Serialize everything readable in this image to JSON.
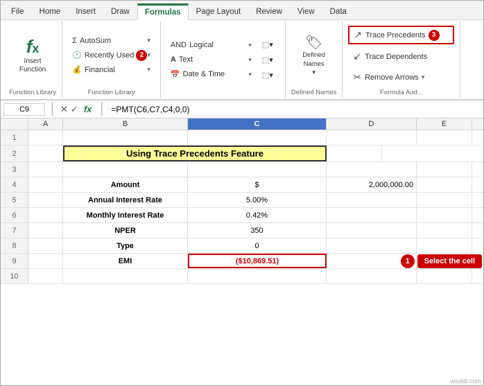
{
  "title": "wsxkb.com",
  "tabs": [
    {
      "label": "File",
      "active": false
    },
    {
      "label": "Home",
      "active": false
    },
    {
      "label": "Insert",
      "active": false
    },
    {
      "label": "Draw",
      "active": false
    },
    {
      "label": "Formulas",
      "active": true
    },
    {
      "label": "Page Layout",
      "active": false
    },
    {
      "label": "Review",
      "active": false
    },
    {
      "label": "View",
      "active": false
    },
    {
      "label": "Data",
      "active": false
    }
  ],
  "ribbon": {
    "function_library_label": "Function Library",
    "insert_function": {
      "label": "Insert\nFunction",
      "icon": "𝑓𝑥"
    },
    "autosum": {
      "label": "AutoSum",
      "arrow": "▾"
    },
    "recently_used": {
      "label": "Recently Used",
      "arrow": "▾"
    },
    "financial": {
      "label": "Financial",
      "arrow": "▾"
    },
    "logical": {
      "label": "Logical",
      "arrow": "▾"
    },
    "text": {
      "label": "Text",
      "arrow": "▾"
    },
    "date_time": {
      "label": "Date & Time",
      "arrow": "▾"
    },
    "more_col1_btn1": "▤",
    "more_col1_btn2": "▤",
    "more_col1_btn3": "▤",
    "defined_names_label": "Defined\nNames",
    "formula_audit_label": "Formula Aud...",
    "trace_precedents": "Trace Precedents",
    "trace_dependents": "Trace Dependents",
    "remove_arrows": "Remove Arrows",
    "badge2": "2",
    "badge3": "3"
  },
  "formula_bar": {
    "cell_ref": "C9",
    "formula": "=PMT(C6,C7,C4,0,0)"
  },
  "spreadsheet": {
    "col_headers": [
      "A",
      "B",
      "C",
      "D",
      "E"
    ],
    "rows": [
      {
        "num": "1",
        "cells": [
          "",
          "",
          "",
          "",
          ""
        ]
      },
      {
        "num": "2",
        "cells": [
          "",
          "Using Trace Precedents Feature",
          "",
          "",
          ""
        ]
      },
      {
        "num": "3",
        "cells": [
          "",
          "",
          "",
          "",
          ""
        ]
      },
      {
        "num": "4",
        "cells": [
          "",
          "Amount",
          "$",
          "2,000,000.00",
          ""
        ]
      },
      {
        "num": "5",
        "cells": [
          "",
          "Annual Interest Rate",
          "5.00%",
          "",
          ""
        ]
      },
      {
        "num": "6",
        "cells": [
          "",
          "Monthly Interest Rate",
          "0.42%",
          "",
          ""
        ]
      },
      {
        "num": "7",
        "cells": [
          "",
          "NPER",
          "350",
          "",
          ""
        ]
      },
      {
        "num": "8",
        "cells": [
          "",
          "Type",
          "0",
          "",
          ""
        ]
      },
      {
        "num": "9",
        "cells": [
          "",
          "EMI",
          "($10,869.51)",
          "",
          ""
        ]
      }
    ]
  },
  "annotations": {
    "badge1_label": "1",
    "badge2_label": "2",
    "badge3_label": "3",
    "select_cell_btn": "Select the cell"
  }
}
